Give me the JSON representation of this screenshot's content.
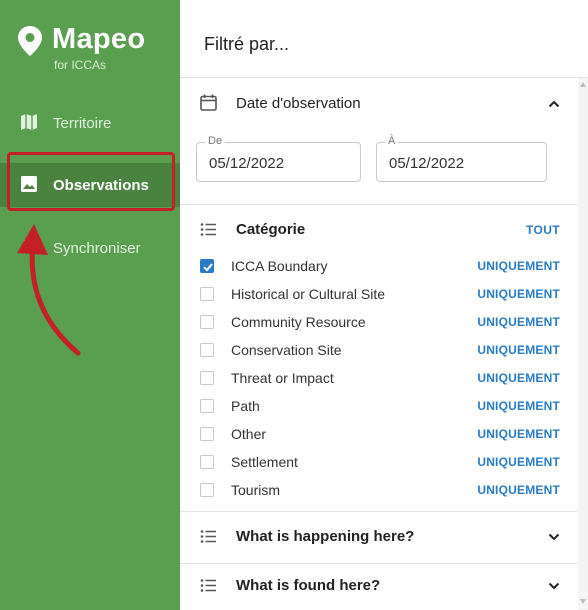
{
  "brand": {
    "name": "Mapeo",
    "subtitle": "for ICCAs"
  },
  "nav": [
    {
      "label": "Territoire",
      "icon": "map-icon",
      "active": false
    },
    {
      "label": "Observations",
      "icon": "photo-icon",
      "active": true
    },
    {
      "label": "Synchroniser",
      "icon": "sync-icon",
      "active": false
    }
  ],
  "panel": {
    "title": "Filtré par..."
  },
  "date_section": {
    "title": "Date d'observation",
    "from_label": "De",
    "from_value": "05/12/2022",
    "to_label": "À",
    "to_value": "05/12/2022"
  },
  "category_section": {
    "title": "Catégorie",
    "all_label": "TOUT",
    "only_label": "UNIQUEMENT",
    "items": [
      {
        "label": "ICCA Boundary",
        "checked": true
      },
      {
        "label": "Historical or Cultural Site",
        "checked": false
      },
      {
        "label": "Community Resource",
        "checked": false
      },
      {
        "label": "Conservation Site",
        "checked": false
      },
      {
        "label": "Threat or Impact",
        "checked": false
      },
      {
        "label": "Path",
        "checked": false
      },
      {
        "label": "Other",
        "checked": false
      },
      {
        "label": "Settlement",
        "checked": false
      },
      {
        "label": "Tourism",
        "checked": false
      }
    ]
  },
  "collapsed_sections": [
    {
      "title": "What is happening here?"
    },
    {
      "title": "What is found here?"
    }
  ],
  "colors": {
    "sidebar": "#5a9e4f",
    "accent": "#2a7cc7",
    "highlight": "#c42027"
  }
}
